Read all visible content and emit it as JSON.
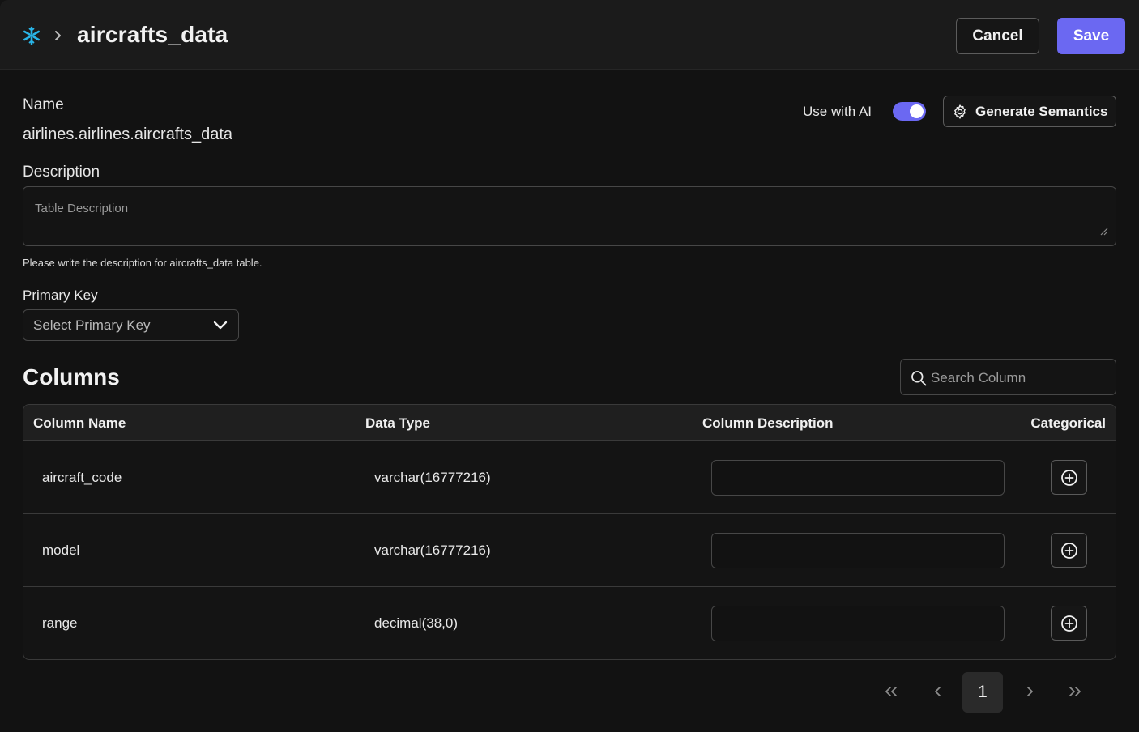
{
  "header": {
    "title": "aircrafts_data",
    "cancel_label": "Cancel",
    "save_label": "Save",
    "accent_color": "#6b68f2",
    "logo_icon": "snowflake-icon"
  },
  "form": {
    "name_label": "Name",
    "name_value": "airlines.airlines.aircrafts_data",
    "use_ai_label": "Use with AI",
    "use_ai_enabled": true,
    "generate_label": "Generate Semantics",
    "description_label": "Description",
    "description_placeholder": "Table Description",
    "description_help": "Please write the description for aircrafts_data table.",
    "primary_key_label": "Primary Key",
    "primary_key_value": "Select Primary Key"
  },
  "columns": {
    "title": "Columns",
    "search_placeholder": "Search Column",
    "headers": {
      "name": "Column Name",
      "type": "Data Type",
      "description": "Column Description",
      "categorical": "Categorical"
    },
    "rows": [
      {
        "name": "aircraft_code",
        "type": "varchar(16777216)",
        "description": ""
      },
      {
        "name": "model",
        "type": "varchar(16777216)",
        "description": ""
      },
      {
        "name": "range",
        "type": "decimal(38,0)",
        "description": ""
      }
    ]
  },
  "pagination": {
    "current_page": "1"
  }
}
